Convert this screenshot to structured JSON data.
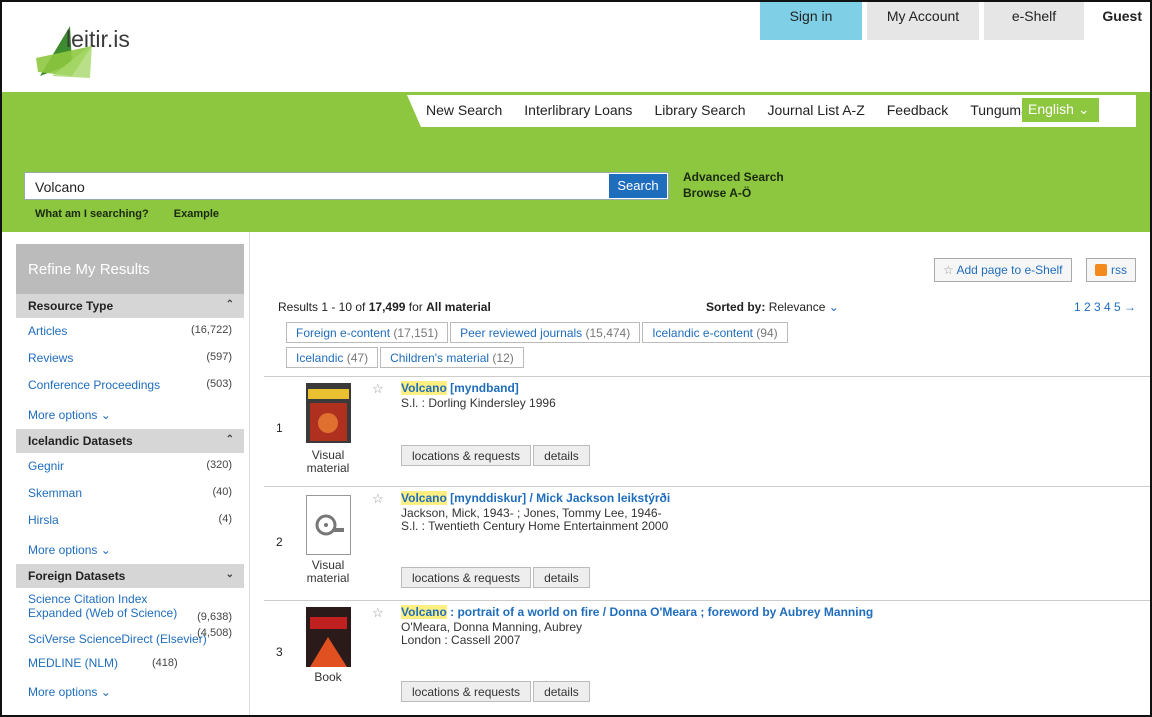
{
  "header": {
    "logo_text": "leitir.is",
    "account": {
      "sign_in": "Sign in",
      "my_account": "My Account",
      "eshelf": "e-Shelf",
      "guest": "Guest"
    },
    "nav": [
      "New Search",
      "Interlibrary Loans",
      "Library Search",
      "Journal List A-Z",
      "Feedback"
    ],
    "language_label": "Tungumál:",
    "language_value": "English",
    "colors": {
      "green": "#8dc63f",
      "signin": "#7fd0e6"
    }
  },
  "search": {
    "value": "Volcano",
    "button": "Search",
    "advanced": "Advanced Search",
    "browse": "Browse A-Ö",
    "hint_what": "What am I searching?",
    "hint_example": "Example"
  },
  "sidebar": {
    "title": "Refine My Results",
    "facets": [
      {
        "title": "Resource Type",
        "items": [
          {
            "label": "Articles",
            "count": "(16,722)"
          },
          {
            "label": "Reviews",
            "count": "(597)"
          },
          {
            "label": "Conference Proceedings",
            "count": "(503)"
          }
        ],
        "more": "More options"
      },
      {
        "title": "Icelandic Datasets",
        "items": [
          {
            "label": "Gegnir",
            "count": "(320)"
          },
          {
            "label": "Skemman",
            "count": "(40)"
          },
          {
            "label": "Hirsla",
            "count": "(4)"
          }
        ],
        "more": "More options"
      },
      {
        "title": "Foreign Datasets",
        "items": [
          {
            "label": "Science Citation Index Expanded (Web of Science)",
            "count": "(9,638)"
          },
          {
            "label": "SciVerse ScienceDirect (Elsevier)",
            "count": "(4,508)"
          },
          {
            "label": "MEDLINE (NLM)",
            "count": "(418)"
          }
        ],
        "more": "More options"
      }
    ]
  },
  "results": {
    "add_page": "Add page to e-Shelf",
    "rss": "rss",
    "summary_prefix": "Results 1 - 10 of",
    "total": "17,499",
    "summary_for": "for",
    "scope": "All material",
    "sorted_label": "Sorted by:",
    "sorted_value": "Relevance",
    "pages": "1 2 3 4 5 →",
    "chips": [
      {
        "label": "Foreign e-content",
        "count": "(17,151)"
      },
      {
        "label": "Peer reviewed journals",
        "count": "(15,474)"
      },
      {
        "label": "Icelandic e-content",
        "count": "(94)"
      },
      {
        "label": "Icelandic",
        "count": "(47)"
      },
      {
        "label": "Children's material",
        "count": "(12)"
      }
    ],
    "buttons": {
      "locations": "locations & requests",
      "details": "details"
    },
    "items": [
      {
        "num": "1",
        "highlight": "Volcano",
        "title_rest": " [myndband]",
        "meta1": "S.l. : Dorling Kindersley 1996",
        "meta2": "",
        "type": "Visual material"
      },
      {
        "num": "2",
        "highlight": "Volcano",
        "title_rest": " [mynddiskur] / Mick Jackson leikstýrði",
        "meta1": "Jackson, Mick, 1943- ; Jones, Tommy Lee, 1946-",
        "meta2": "S.l. : Twentieth Century Home Entertainment 2000",
        "type": "Visual material"
      },
      {
        "num": "3",
        "highlight": "Volcano",
        "title_rest": " : portrait of a world on fire / Donna O'Meara ; foreword by Aubrey Manning",
        "meta1": "O'Meara, Donna Manning, Aubrey",
        "meta2": "London : Cassell 2007",
        "type": "Book"
      }
    ]
  }
}
